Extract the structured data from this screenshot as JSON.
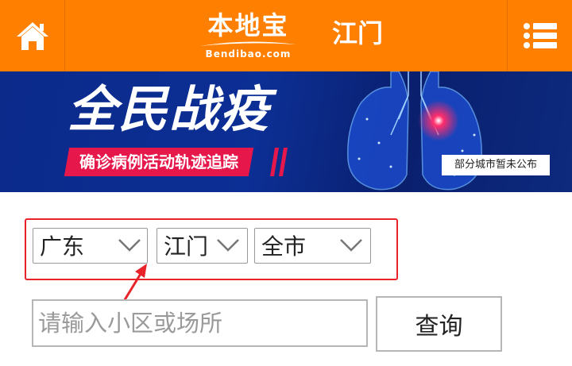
{
  "header": {
    "home_icon": "home-icon",
    "logo_text": "本地宝",
    "logo_subtext": "Bendibao.com",
    "city": "江门",
    "menu_icon": "menu-icon",
    "bg_color": "#ff7f00"
  },
  "banner": {
    "title": "全民战疫",
    "subtitle": "确诊病例活动轨迹追踪",
    "note": "部分城市暂未公布",
    "image": "lungs-illustration"
  },
  "filters": {
    "province": "广东",
    "city": "江门",
    "district": "全市",
    "highlight_color": "#e8242a"
  },
  "search": {
    "placeholder": "请输入小区或场所",
    "button_label": "查询"
  }
}
